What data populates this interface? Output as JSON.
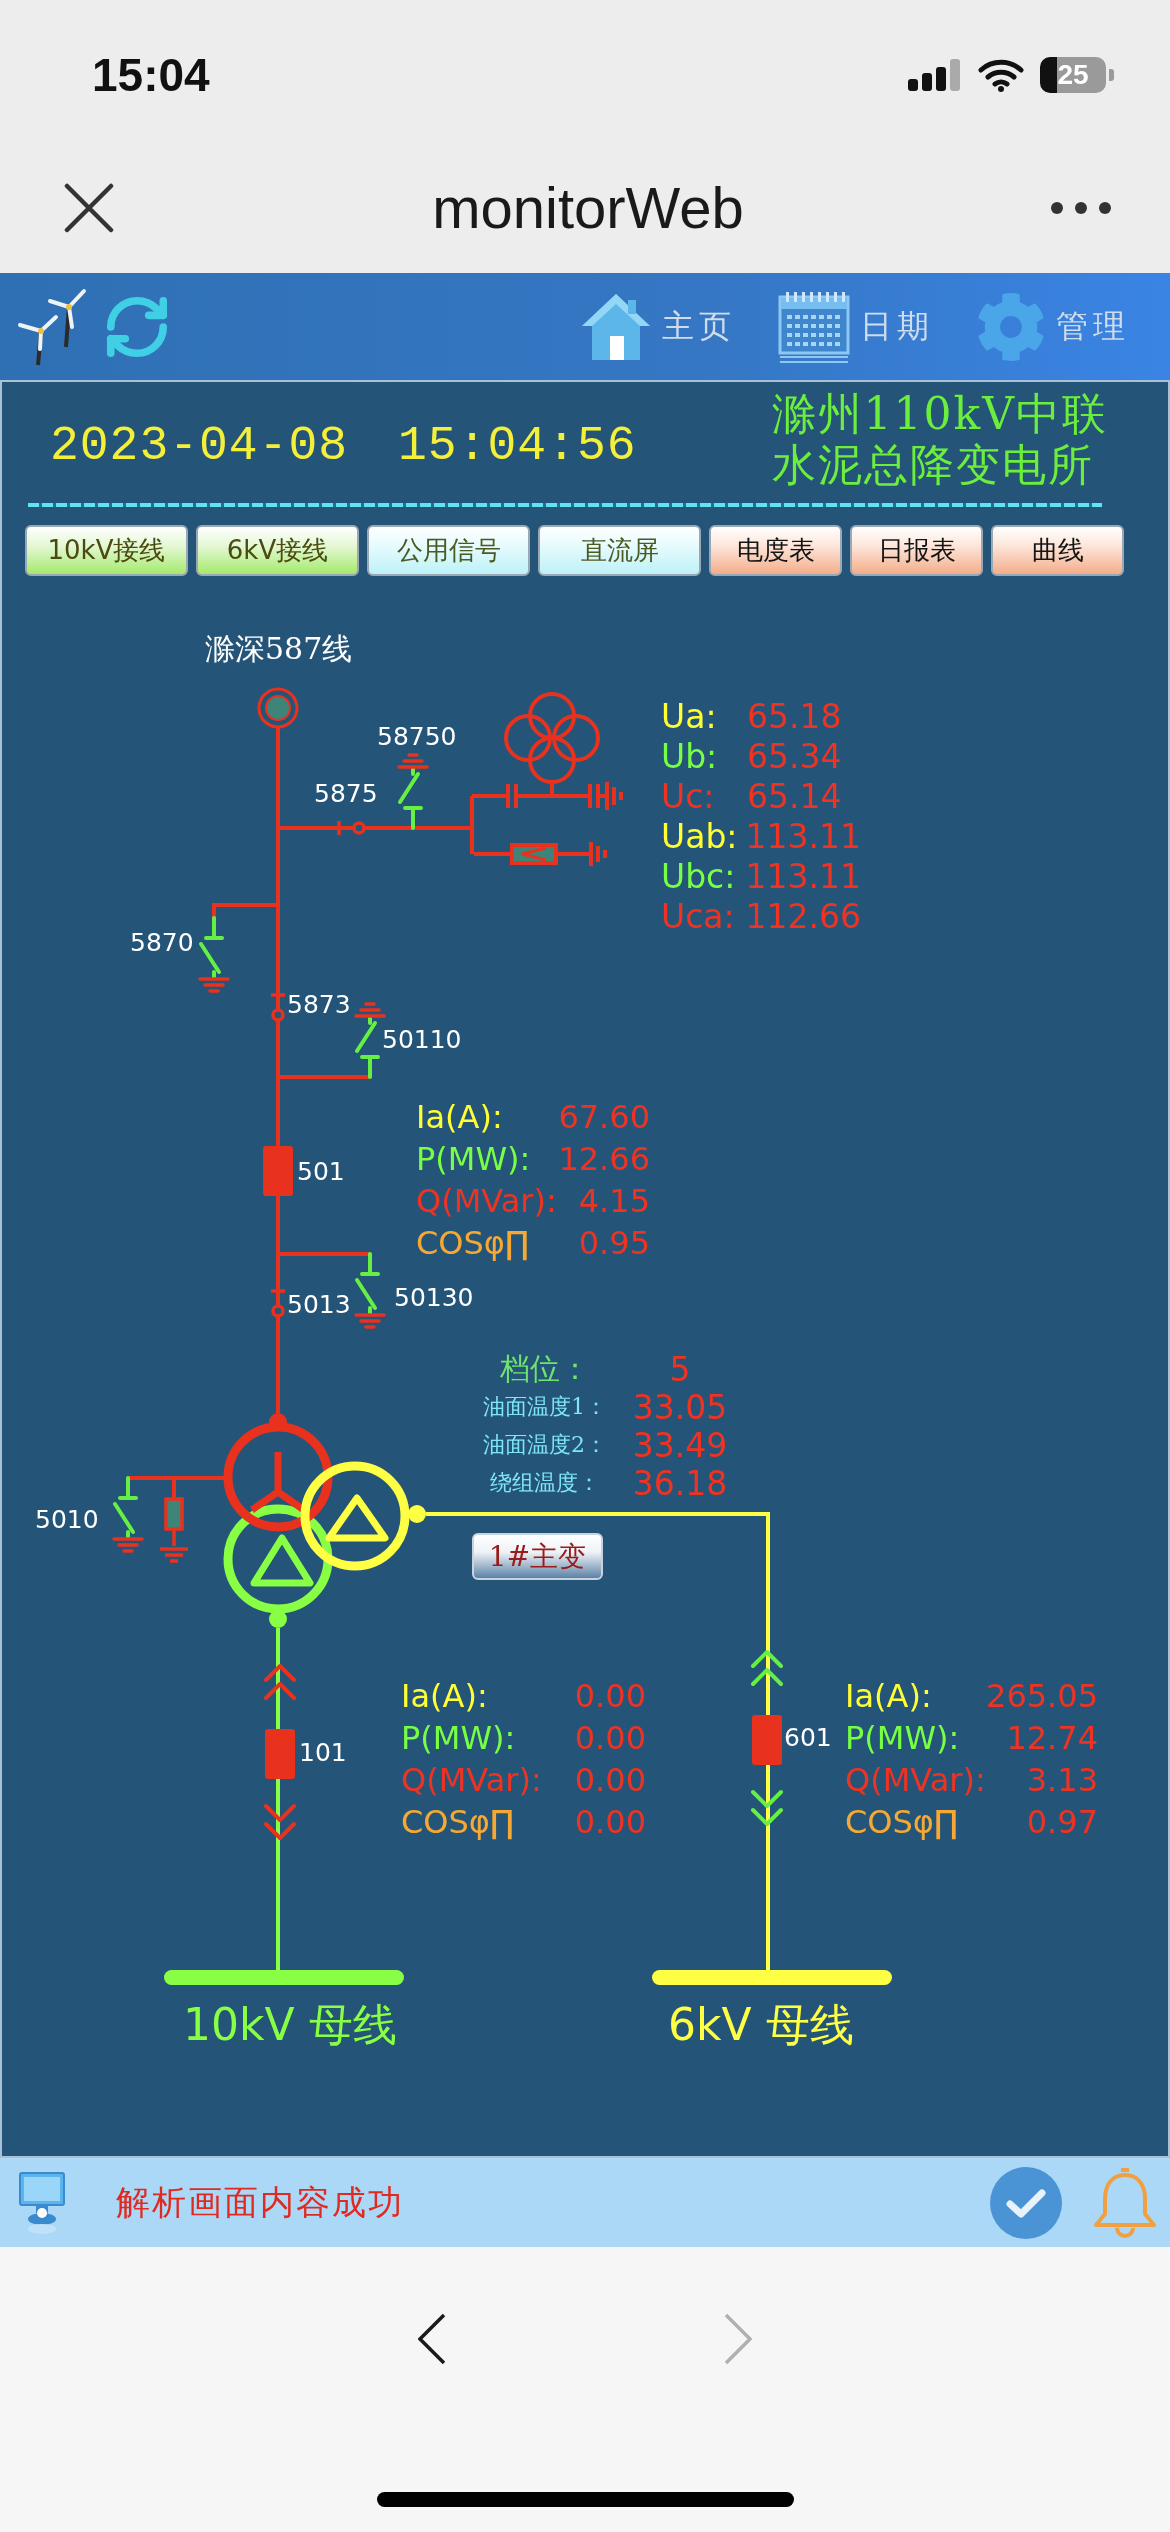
{
  "status_bar": {
    "time": "15:04",
    "battery": "25"
  },
  "browser": {
    "title": "monitorWeb"
  },
  "nav": {
    "items": [
      {
        "kind": "home",
        "label": "主页"
      },
      {
        "kind": "calendar",
        "label": "日期"
      },
      {
        "kind": "settings",
        "label": "管理"
      }
    ]
  },
  "header": {
    "date": "2023-04-08",
    "time": "15:04:56",
    "station": [
      "滁州110kV中联",
      "水泥总降变电所"
    ]
  },
  "buttons": [
    {
      "label": "10kV接线",
      "kind": "wiring"
    },
    {
      "label": "6kV接线",
      "kind": "wiring"
    },
    {
      "label": "公用信号",
      "kind": "panel"
    },
    {
      "label": "直流屏",
      "kind": "panel"
    },
    {
      "label": "电度表",
      "kind": "report"
    },
    {
      "label": "日报表",
      "kind": "report"
    },
    {
      "label": "曲线",
      "kind": "report"
    }
  ],
  "diagram": {
    "incoming_line": "滁深587线",
    "switches": [
      {
        "label": "58750",
        "kind": "earth",
        "closed": false
      },
      {
        "label": "5875",
        "kind": "disconnector",
        "closed": true
      },
      {
        "label": "5870",
        "kind": "earth",
        "closed": false
      },
      {
        "label": "5873",
        "kind": "disconnector",
        "closed": true
      },
      {
        "label": "50110",
        "kind": "earth",
        "closed": false
      },
      {
        "label": "501",
        "kind": "breaker",
        "closed": true
      },
      {
        "label": "5013",
        "kind": "disconnector",
        "closed": true
      },
      {
        "label": "50130",
        "kind": "earth",
        "closed": false
      },
      {
        "label": "5010",
        "kind": "earth",
        "closed": false
      },
      {
        "label": "101",
        "kind": "breaker",
        "closed": true,
        "racked_in": true
      },
      {
        "label": "601",
        "kind": "breaker",
        "closed": true,
        "racked_in": false
      }
    ],
    "voltages": [
      {
        "label": "Ua:",
        "value": "65.18",
        "color": "#ffff33"
      },
      {
        "label": "Ub:",
        "value": "65.34",
        "color": "#77ff44"
      },
      {
        "label": "Uc:",
        "value": "65.14",
        "color": "#ee3322"
      },
      {
        "label": "Uab:",
        "value": "113.11",
        "color": "#ffff33"
      },
      {
        "label": "Ubc:",
        "value": "113.11",
        "color": "#77ff44"
      },
      {
        "label": "Uca:",
        "value": "112.66",
        "color": "#ee3322"
      }
    ],
    "measurements": [
      {
        "rows": [
          {
            "label": "Ia(A):",
            "value": "67.60",
            "color": "#ffff33"
          },
          {
            "label": "P(MW):",
            "value": "12.66",
            "color": "#77ff44"
          },
          {
            "label": "Q(MVar):",
            "value": "4.15",
            "color": "#ee3322"
          },
          {
            "label": "COSφ∏",
            "value": "0.95",
            "color": "#f5a833"
          }
        ]
      },
      {
        "rows": [
          {
            "label": "Ia(A):",
            "value": "0.00",
            "color": "#ffff33"
          },
          {
            "label": "P(MW):",
            "value": "0.00",
            "color": "#77ff44"
          },
          {
            "label": "Q(MVar):",
            "value": "0.00",
            "color": "#ee3322"
          },
          {
            "label": "COSφ∏",
            "value": "0.00",
            "color": "#f5a833"
          }
        ]
      },
      {
        "rows": [
          {
            "label": "Ia(A):",
            "value": "265.05",
            "color": "#ffff33"
          },
          {
            "label": "P(MW):",
            "value": "12.74",
            "color": "#77ff44"
          },
          {
            "label": "Q(MVar):",
            "value": "3.13",
            "color": "#ee3322"
          },
          {
            "label": "COSφ∏",
            "value": "0.97",
            "color": "#f5a833"
          }
        ]
      }
    ],
    "transformer": {
      "name": "1#主变",
      "readings": [
        {
          "kind": "tap",
          "label": "档位：",
          "value": "5"
        },
        {
          "kind": "temperature",
          "label": "油面温度1：",
          "value": "33.05"
        },
        {
          "kind": "temperature",
          "label": "油面温度2：",
          "value": "33.49"
        },
        {
          "kind": "temperature",
          "label": "绕组温度：",
          "value": "36.18"
        }
      ]
    },
    "buses": [
      {
        "label": "10kV 母线",
        "color": "#88ff44"
      },
      {
        "label": "6kV 母线",
        "color": "#ffff44"
      }
    ]
  },
  "footer": {
    "message": "解析画面内容成功"
  },
  "toolbar": {
    "back": {
      "disabled": false
    },
    "forward": {
      "disabled": true
    }
  }
}
